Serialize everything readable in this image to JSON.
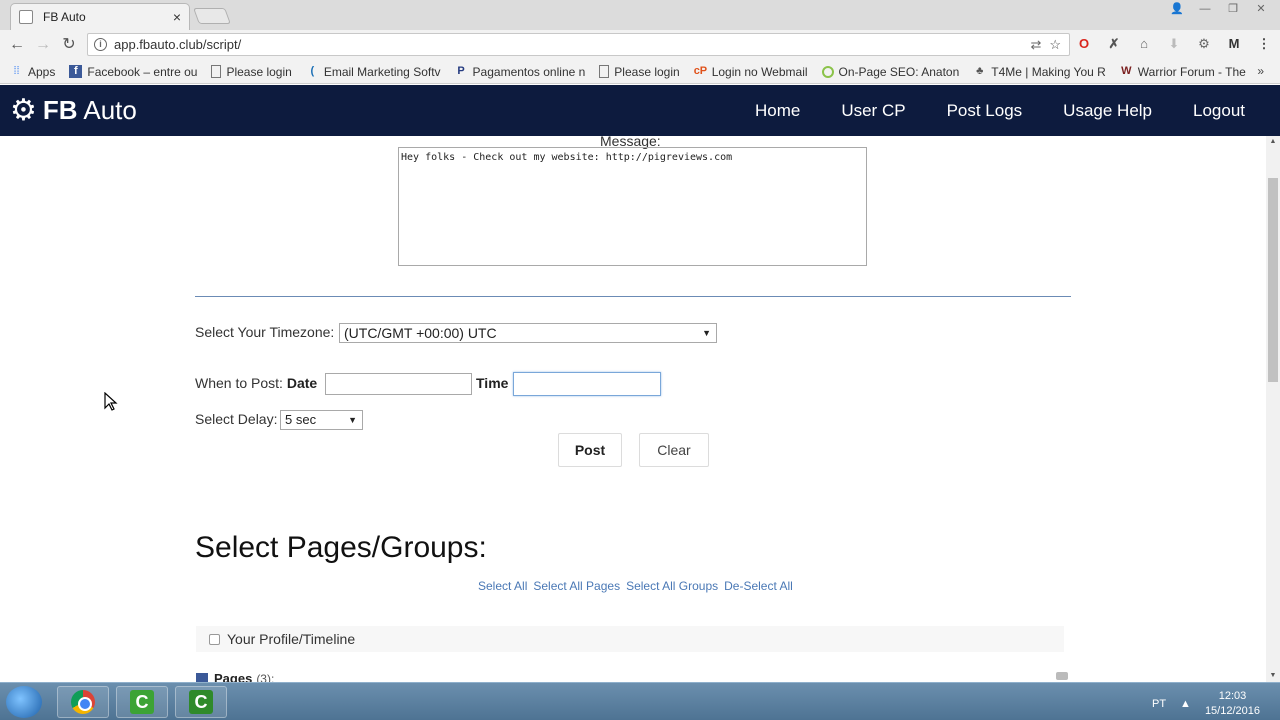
{
  "browser": {
    "tab_title": "FB Auto",
    "tab_close": "×",
    "url": "app.fbauto.club/script/",
    "bookmarks": [
      {
        "label": "Apps",
        "icon": "apps-grid-icon"
      },
      {
        "label": "Facebook – entre ou",
        "icon": "facebook-icon"
      },
      {
        "label": "Please login",
        "icon": "page-icon"
      },
      {
        "label": "Email Marketing Softv",
        "icon": "email-marketing-icon"
      },
      {
        "label": "Pagamentos online n",
        "icon": "paypal-icon"
      },
      {
        "label": "Please login",
        "icon": "page-icon"
      },
      {
        "label": "Login no Webmail",
        "icon": "webmail-icon"
      },
      {
        "label": "On-Page SEO: Anaton",
        "icon": "seo-icon"
      },
      {
        "label": "T4Me | Making You R",
        "icon": "t4me-icon"
      },
      {
        "label": "Warrior Forum - The",
        "icon": "warrior-forum-icon"
      }
    ],
    "more_bookmarks": "»"
  },
  "site": {
    "logo_bold": "FB",
    "logo_rest": " Auto",
    "nav": [
      "Home",
      "User CP",
      "Post Logs",
      "Usage Help",
      "Logout"
    ]
  },
  "form": {
    "message_label": "Message:",
    "message_value": "Hey folks - Check out my website: http://pigreviews.com",
    "timezone_label": "Select Your Timezone:",
    "timezone_value": "(UTC/GMT +00:00) UTC",
    "when_label": "When to Post:",
    "date_label": "Date",
    "date_value": "",
    "time_label": "Time",
    "time_value": "",
    "delay_label": "Select Delay:",
    "delay_value": "5 sec",
    "post_button": "Post",
    "clear_button": "Clear"
  },
  "targets": {
    "title": "Select Pages/Groups:",
    "links": [
      "Select All",
      "Select All Pages",
      "Select All Groups",
      "De-Select All"
    ],
    "profile_label": "Your Profile/Timeline",
    "pages_label": "Pages",
    "pages_count": "(3):"
  },
  "taskbar": {
    "lang": "PT",
    "time": "12:03",
    "date": "15/12/2016"
  }
}
